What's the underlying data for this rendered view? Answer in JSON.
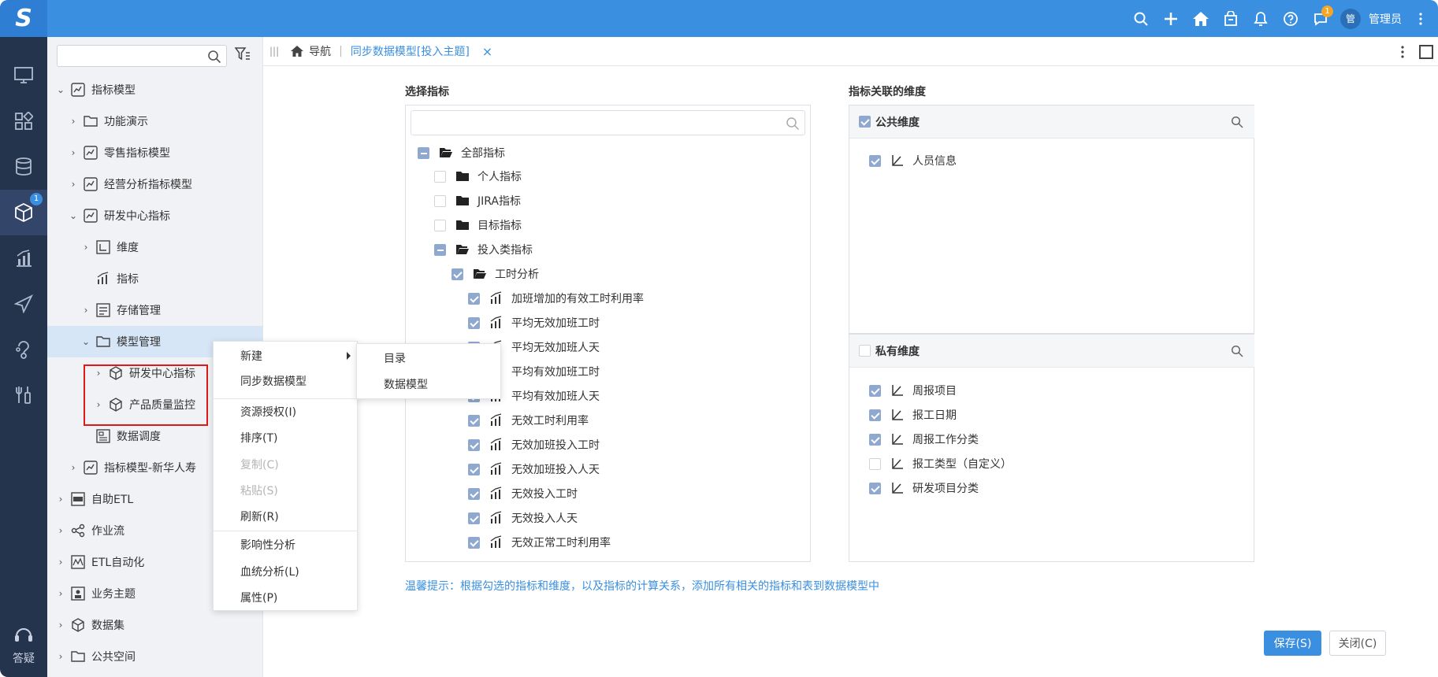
{
  "header": {
    "logo": "S",
    "username": "管理员",
    "avatar": "管",
    "messages_badge": "1"
  },
  "rail": {
    "badge": "1",
    "help_label": "答疑"
  },
  "tree": {
    "items": [
      {
        "label": "指标模型"
      },
      {
        "label": "功能演示"
      },
      {
        "label": "零售指标模型"
      },
      {
        "label": "经营分析指标模型"
      },
      {
        "label": "研发中心指标"
      },
      {
        "label": "维度"
      },
      {
        "label": "指标"
      },
      {
        "label": "存储管理"
      },
      {
        "label": "模型管理"
      },
      {
        "label": "研发中心指标"
      },
      {
        "label": "产品质量监控"
      },
      {
        "label": "数据调度"
      },
      {
        "label": "指标模型-新华人寿"
      },
      {
        "label": "自助ETL"
      },
      {
        "label": "作业流"
      },
      {
        "label": "ETL自动化"
      },
      {
        "label": "业务主题"
      },
      {
        "label": "数据集"
      },
      {
        "label": "公共空间"
      }
    ]
  },
  "tabs": {
    "home_label": "导航",
    "active_tab": "同步数据模型[投入主题]",
    "close": "×"
  },
  "metrics": {
    "title": "选择指标",
    "nodes": [
      {
        "label": "全部指标"
      },
      {
        "label": "个人指标"
      },
      {
        "label": "JIRA指标"
      },
      {
        "label": "目标指标"
      },
      {
        "label": "投入类指标"
      },
      {
        "label": "工时分析"
      },
      {
        "label": "加班增加的有效工时利用率"
      },
      {
        "label": "平均无效加班工时"
      },
      {
        "label": "平均无效加班人天"
      },
      {
        "label": "平均有效加班工时"
      },
      {
        "label": "平均有效加班人天"
      },
      {
        "label": "无效工时利用率"
      },
      {
        "label": "无效加班投入工时"
      },
      {
        "label": "无效加班投入人天"
      },
      {
        "label": "无效投入工时"
      },
      {
        "label": "无效投入人天"
      },
      {
        "label": "无效正常工时利用率"
      }
    ]
  },
  "dimensions": {
    "title": "指标关联的维度",
    "public_title": "公共维度",
    "public_items": [
      {
        "label": "人员信息"
      }
    ],
    "private_title": "私有维度",
    "private_items": [
      {
        "label": "周报项目"
      },
      {
        "label": "报工日期"
      },
      {
        "label": "周报工作分类"
      },
      {
        "label": "报工类型（自定义）"
      },
      {
        "label": "研发项目分类"
      }
    ]
  },
  "hint": "温馨提示：根据勾选的指标和维度，以及指标的计算关系，添加所有相关的指标和表到数据模型中",
  "buttons": {
    "save": "保存(S)",
    "close": "关闭(C)"
  },
  "context_menu": {
    "items": [
      {
        "label": "新建"
      },
      {
        "label": "同步数据模型"
      },
      {
        "label": "资源授权(I)"
      },
      {
        "label": "排序(T)"
      },
      {
        "label": "复制(C)"
      },
      {
        "label": "粘贴(S)"
      },
      {
        "label": "刷新(R)"
      },
      {
        "label": "影响性分析"
      },
      {
        "label": "血统分析(L)"
      },
      {
        "label": "属性(P)"
      }
    ],
    "submenu": [
      {
        "label": "目录"
      },
      {
        "label": "数据模型"
      }
    ]
  },
  "colors": {
    "accent": "#3a8fe0",
    "rail": "#25344d",
    "checkbox": "#8ea8cf",
    "highlight": "#e01818"
  }
}
